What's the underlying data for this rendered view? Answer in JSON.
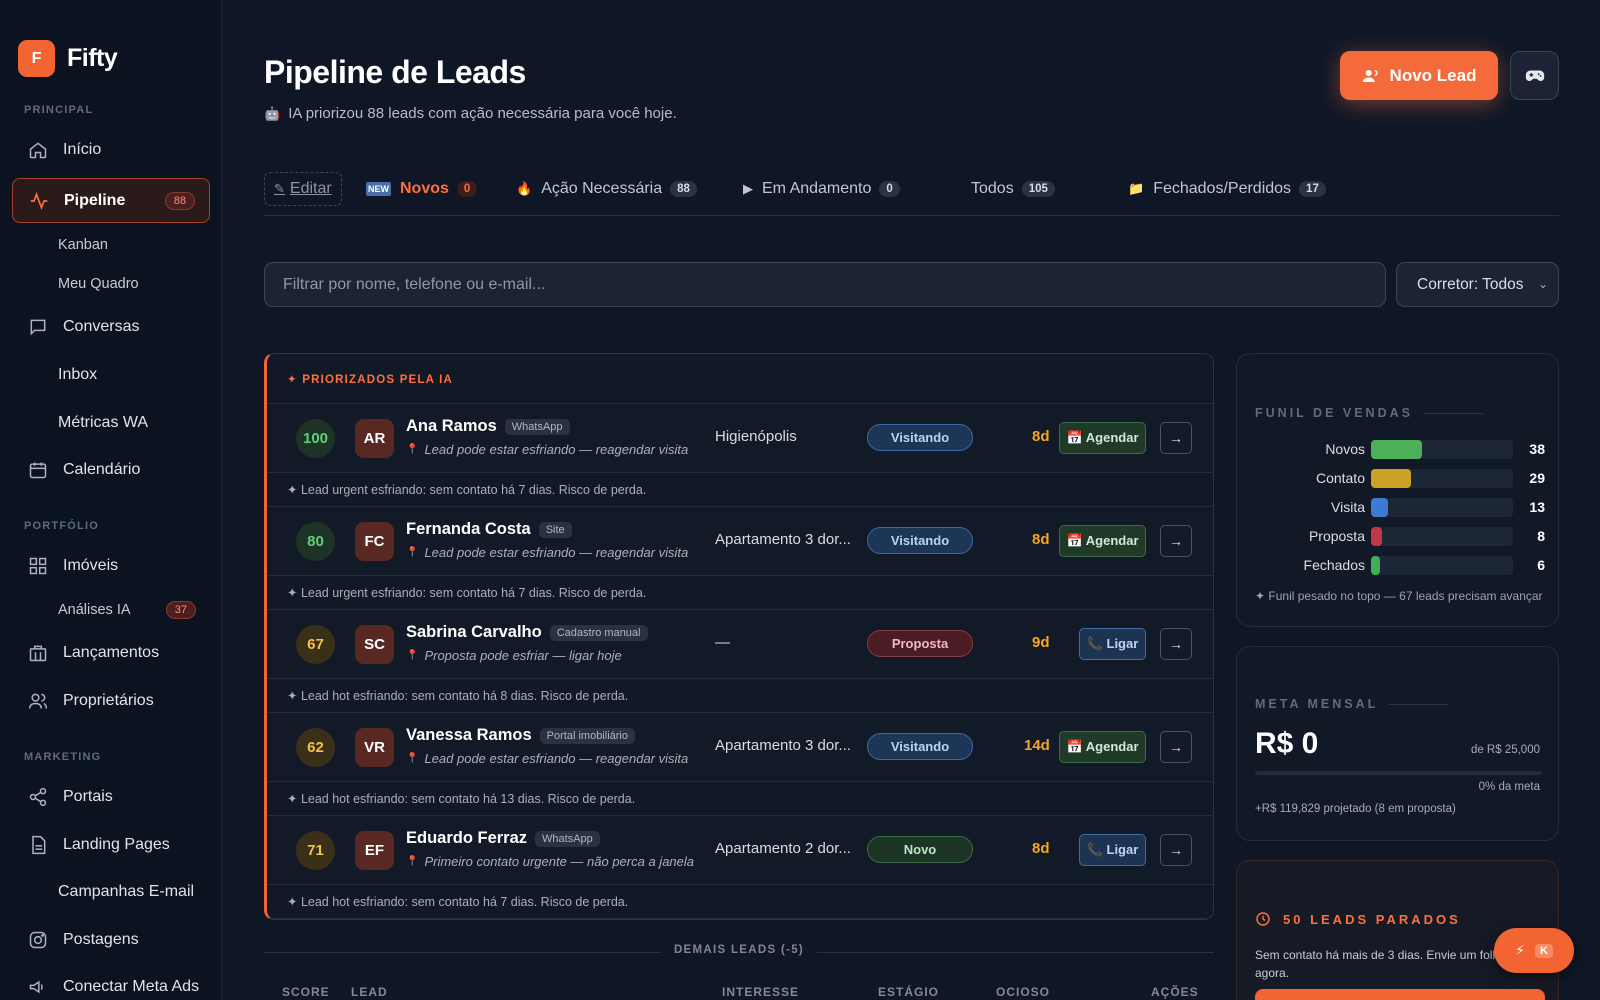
{
  "brand": {
    "mark": "F",
    "name": "Fifty"
  },
  "sidebar": {
    "sections": {
      "principal": "PRINCIPAL",
      "portfolio": "PORTFÓLIO",
      "marketing": "MARKETING"
    },
    "inicio": "Início",
    "pipeline": "Pipeline",
    "pipeline_badge": "88",
    "kanban": "Kanban",
    "meu_quadro": "Meu Quadro",
    "conversas": "Conversas",
    "inbox": "Inbox",
    "metricas": "Métricas WA",
    "calendario": "Calendário",
    "imoveis": "Imóveis",
    "analises": "Análises IA",
    "analises_badge": "37",
    "lancamentos": "Lançamentos",
    "proprietarios": "Proprietários",
    "portais": "Portais",
    "landing": "Landing Pages",
    "campanhas": "Campanhas E-mail",
    "postagens": "Postagens",
    "meta_ads": "Conectar Meta Ads"
  },
  "header": {
    "title": "Pipeline de Leads",
    "subtitle": "IA priorizou 88 leads com ação necessária para você hoje.",
    "new_lead": "Novo Lead"
  },
  "tabs": {
    "edit": "Editar",
    "items": [
      {
        "label": "Novos",
        "count": "0"
      },
      {
        "label": "Ação Necessária",
        "count": "88"
      },
      {
        "label": "Em Andamento",
        "count": "0"
      },
      {
        "label": "Todos",
        "count": "105"
      },
      {
        "label": "Fechados/Perdidos",
        "count": "17"
      }
    ]
  },
  "filters": {
    "search_placeholder": "Filtrar por nome, telefone ou e-mail...",
    "corretor": "Corretor: Todos"
  },
  "priority": {
    "title": "✦ PRIORIZADOS PELA IA",
    "leads": [
      {
        "score": "100",
        "initials": "AR",
        "name": "Ana Ramos",
        "source": "WhatsApp",
        "hint": "Lead pode estar esfriando — reagendar visita",
        "interest": "Higienópolis",
        "stage": "Visitando",
        "idle": "8d",
        "action": "📅 Agendar",
        "note": "✦ Lead urgent esfriando: sem contato há 7 dias. Risco de perda."
      },
      {
        "score": "80",
        "initials": "FC",
        "name": "Fernanda Costa",
        "source": "Site",
        "hint": "Lead pode estar esfriando — reagendar visita",
        "interest": "Apartamento 3 dor...",
        "stage": "Visitando",
        "idle": "8d",
        "action": "📅 Agendar",
        "note": "✦ Lead urgent esfriando: sem contato há 7 dias. Risco de perda."
      },
      {
        "score": "67",
        "initials": "SC",
        "name": "Sabrina Carvalho",
        "source": "Cadastro manual",
        "hint": "Proposta pode esfriar — ligar hoje",
        "interest": "—",
        "stage": "Proposta",
        "idle": "9d",
        "action": "📞 Ligar",
        "note": "✦ Lead hot esfriando: sem contato há 8 dias. Risco de perda."
      },
      {
        "score": "62",
        "initials": "VR",
        "name": "Vanessa Ramos",
        "source": "Portal imobiliário",
        "hint": "Lead pode estar esfriando — reagendar visita",
        "interest": "Apartamento 3 dor...",
        "stage": "Visitando",
        "idle": "14d",
        "action": "📅 Agendar",
        "note": "✦ Lead hot esfriando: sem contato há 13 dias. Risco de perda."
      },
      {
        "score": "71",
        "initials": "EF",
        "name": "Eduardo Ferraz",
        "source": "WhatsApp",
        "hint": "Primeiro contato urgente — não perca a janela",
        "interest": "Apartamento 2 dor...",
        "stage": "Novo",
        "idle": "8d",
        "action": "📞 Ligar",
        "note": "✦ Lead hot esfriando: sem contato há 7 dias. Risco de perda."
      }
    ]
  },
  "others": {
    "title": "DEMAIS LEADS (-5)",
    "columns": {
      "score": "SCORE",
      "lead": "LEAD",
      "interesse": "INTERESSE",
      "estagio": "ESTÁGIO",
      "ocioso": "OCIOSO",
      "acoes": "AÇÕES"
    }
  },
  "funnel": {
    "title": "FUNIL DE VENDAS",
    "rows": [
      {
        "label": "Novos",
        "value": "38",
        "fraction": 0.36,
        "color": "#4caf5a"
      },
      {
        "label": "Contato",
        "value": "29",
        "fraction": 0.28,
        "color": "#c9a227"
      },
      {
        "label": "Visita",
        "value": "13",
        "fraction": 0.12,
        "color": "#3b7bd4"
      },
      {
        "label": "Proposta",
        "value": "8",
        "fraction": 0.08,
        "color": "#c0384a"
      },
      {
        "label": "Fechados",
        "value": "6",
        "fraction": 0.06,
        "color": "#3fae55"
      }
    ],
    "note": "✦ Funil pesado no topo — 67 leads precisam avançar"
  },
  "meta": {
    "title": "META MENSAL",
    "value": "R$ 0",
    "of": "de R$ 25,000",
    "pct": "0% da meta",
    "projection": "+R$ 119,829 projetado (8 em proposta)"
  },
  "stalled": {
    "title": "50 LEADS PARADOS",
    "text": "Sem contato há mais de 3 dias. Envie um follow-up agora."
  },
  "fab": {
    "key": "K"
  }
}
